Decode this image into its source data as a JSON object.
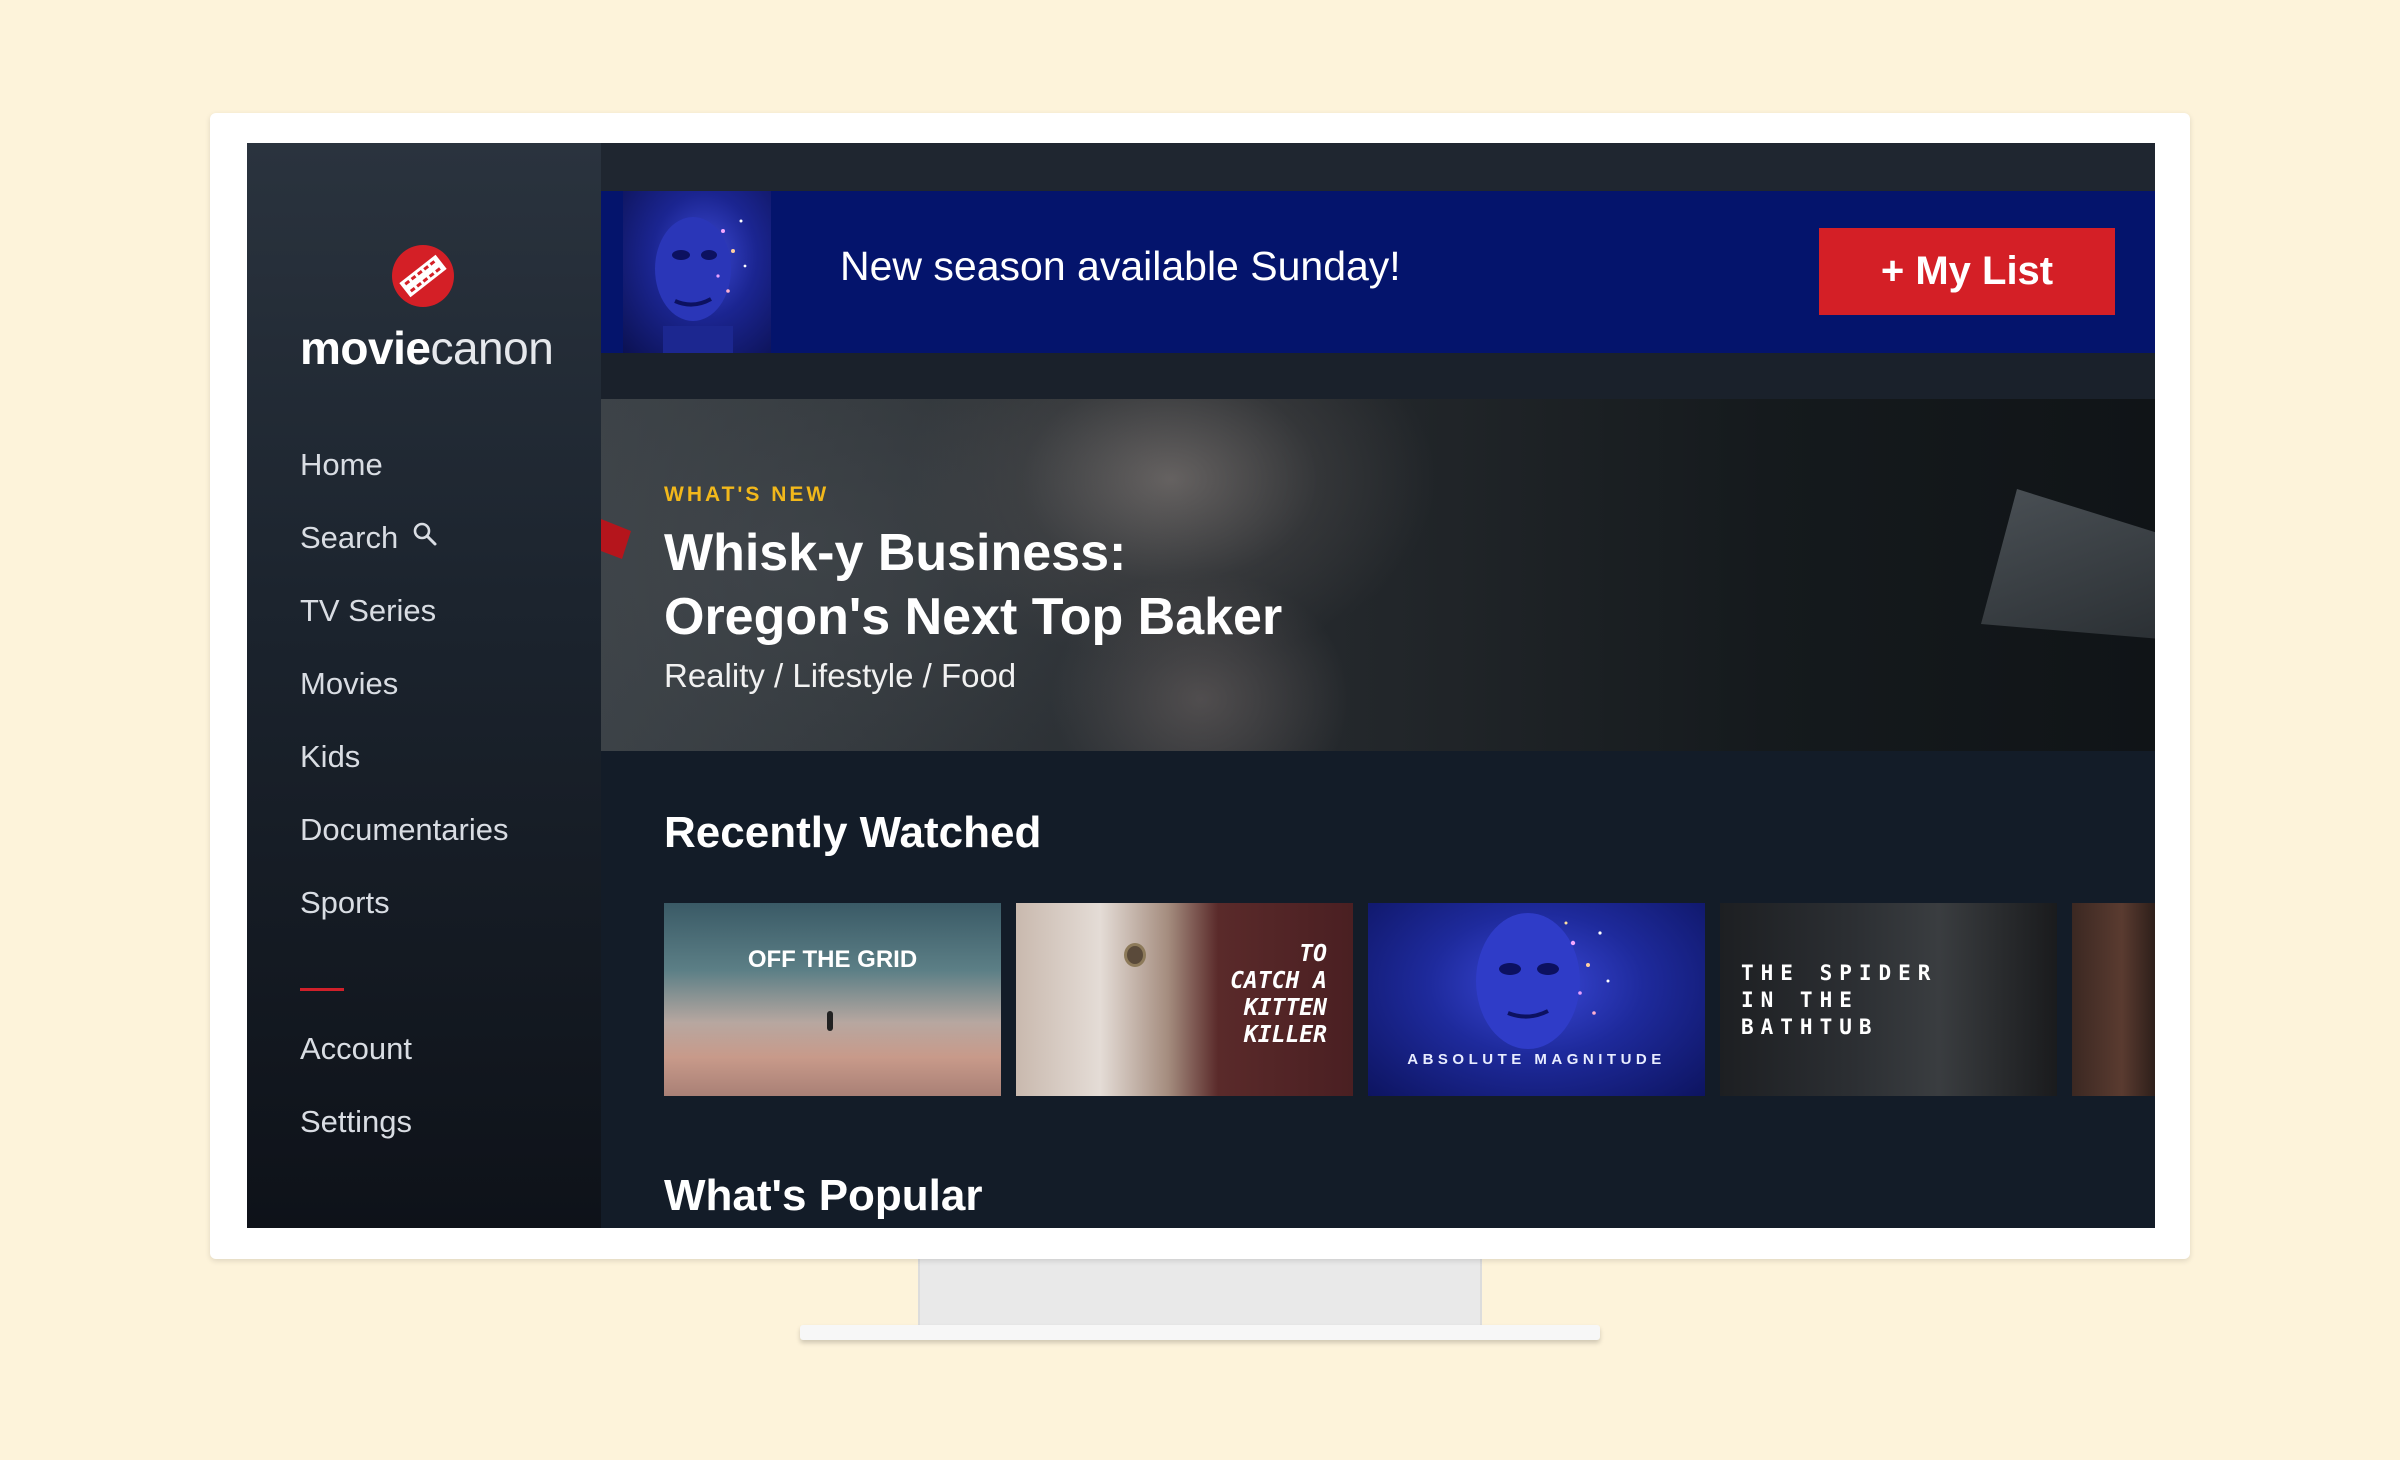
{
  "brand": {
    "name_bold": "movie",
    "name_light": "canon",
    "accent": "#d41f26"
  },
  "sidebar": {
    "items": [
      {
        "label": "Home"
      },
      {
        "label": "Search",
        "icon": "search-icon"
      },
      {
        "label": "TV Series"
      },
      {
        "label": "Movies"
      },
      {
        "label": "Kids"
      },
      {
        "label": "Documentaries"
      },
      {
        "label": "Sports"
      }
    ],
    "secondary": [
      {
        "label": "Account"
      },
      {
        "label": "Settings"
      }
    ]
  },
  "promo": {
    "message": "New season available Sunday!",
    "button_label": "+ My List",
    "background": "#04146c"
  },
  "hero": {
    "kicker": "WHAT'S NEW",
    "title_line1": "Whisk-y Business:",
    "title_line2": "Oregon's Next Top Baker",
    "genres": "Reality / Lifestyle / Food",
    "kicker_color": "#f2b81b"
  },
  "rows": {
    "recently_watched": {
      "title": "Recently Watched",
      "items": [
        {
          "title": "OFF THE GRID"
        },
        {
          "title": "TO\nCATCH A\nKITTEN\nKILLER"
        },
        {
          "title": "ABSOLUTE MAGNITUDE"
        },
        {
          "title": "THE SPIDER\nIN THE\nBATHTUB"
        }
      ]
    },
    "whats_popular": {
      "title": "What's Popular"
    }
  }
}
